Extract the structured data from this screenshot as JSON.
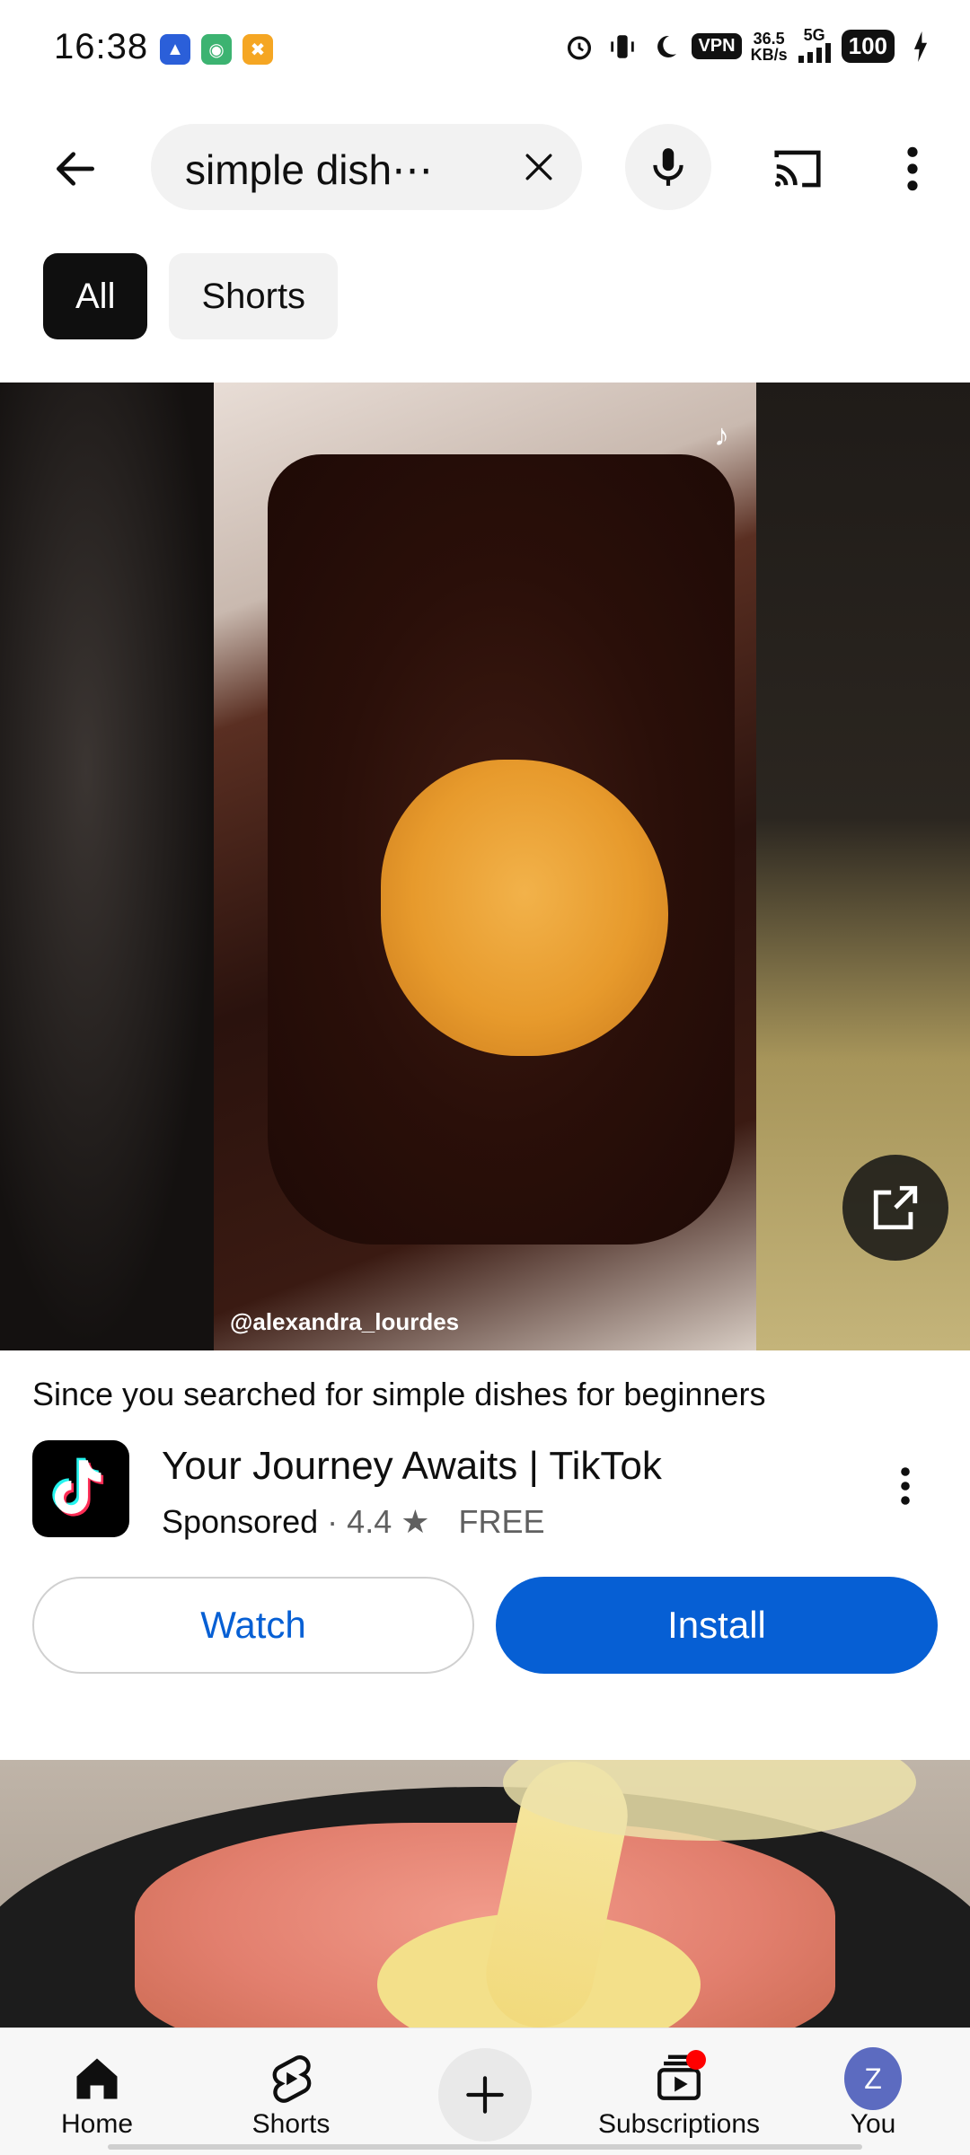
{
  "status_bar": {
    "time": "16:38",
    "vpn_label": "VPN",
    "speed_value": "36.5",
    "speed_unit": "KB/s",
    "network": "5G",
    "battery": "100"
  },
  "search": {
    "query": "simple dish⋯"
  },
  "chips": [
    {
      "label": "All",
      "selected": true
    },
    {
      "label": "Shorts",
      "selected": false
    }
  ],
  "ad": {
    "watermark": "@alexandra_lourdes",
    "context_prefix": "Since you searched for ",
    "context_query": "simple dishes for beginners",
    "title": "Your Journey Awaits | TikTok",
    "sponsored": "Sponsored",
    "separator": "·",
    "rating": "4.4",
    "price": "FREE",
    "watch_label": "Watch",
    "install_label": "Install"
  },
  "bottom_nav": {
    "home": "Home",
    "shorts": "Shorts",
    "subscriptions": "Subscriptions",
    "you": "You",
    "avatar_letter": "Z"
  },
  "colors": {
    "accent_blue": "#065fd4",
    "notification_red": "#ff0000",
    "avatar_purple": "#5c6bc0"
  },
  "icons": [
    "back-arrow-icon",
    "clear-icon",
    "mic-icon",
    "cast-icon",
    "more-vert-icon",
    "open-external-icon",
    "star-icon",
    "home-icon",
    "shorts-icon",
    "create-icon",
    "subscriptions-icon"
  ]
}
